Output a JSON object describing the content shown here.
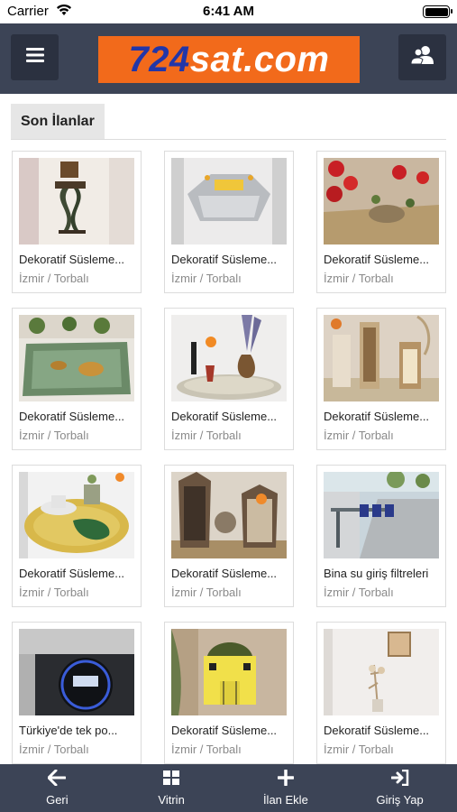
{
  "status_bar": {
    "carrier": "Carrier",
    "time": "6:41 AM"
  },
  "header": {
    "logo_number": "724",
    "logo_rest": "sat.com",
    "menu_icon": "hamburger-menu-icon",
    "user_icon": "users-icon"
  },
  "section": {
    "title": "Son İlanlar"
  },
  "listings": [
    {
      "title": "Dekoratif Süsleme...",
      "location": "İzmir / Torbalı"
    },
    {
      "title": "Dekoratif Süsleme...",
      "location": "İzmir / Torbalı"
    },
    {
      "title": "Dekoratif Süsleme...",
      "location": "İzmir / Torbalı"
    },
    {
      "title": "Dekoratif Süsleme...",
      "location": "İzmir / Torbalı"
    },
    {
      "title": "Dekoratif Süsleme...",
      "location": "İzmir / Torbalı"
    },
    {
      "title": "Dekoratif Süsleme...",
      "location": "İzmir / Torbalı"
    },
    {
      "title": "Dekoratif Süsleme...",
      "location": "İzmir / Torbalı"
    },
    {
      "title": "Dekoratif Süsleme...",
      "location": "İzmir / Torbalı"
    },
    {
      "title": "Bina su giriş filtreleri",
      "location": "İzmir / Torbalı"
    },
    {
      "title": "Türkiye'de tek po...",
      "location": "İzmir / Torbalı"
    },
    {
      "title": "Dekoratif Süsleme...",
      "location": "İzmir / Torbalı"
    },
    {
      "title": "Dekoratif Süsleme...",
      "location": "İzmir / Torbalı"
    }
  ],
  "tabbar": {
    "back": "Geri",
    "showcase": "Vitrin",
    "add_listing": "İlan Ekle",
    "login": "Giriş Yap"
  },
  "colors": {
    "header_bg": "#3c4456",
    "logo_bg": "#f26a1b",
    "logo_number": "#2236a8"
  }
}
